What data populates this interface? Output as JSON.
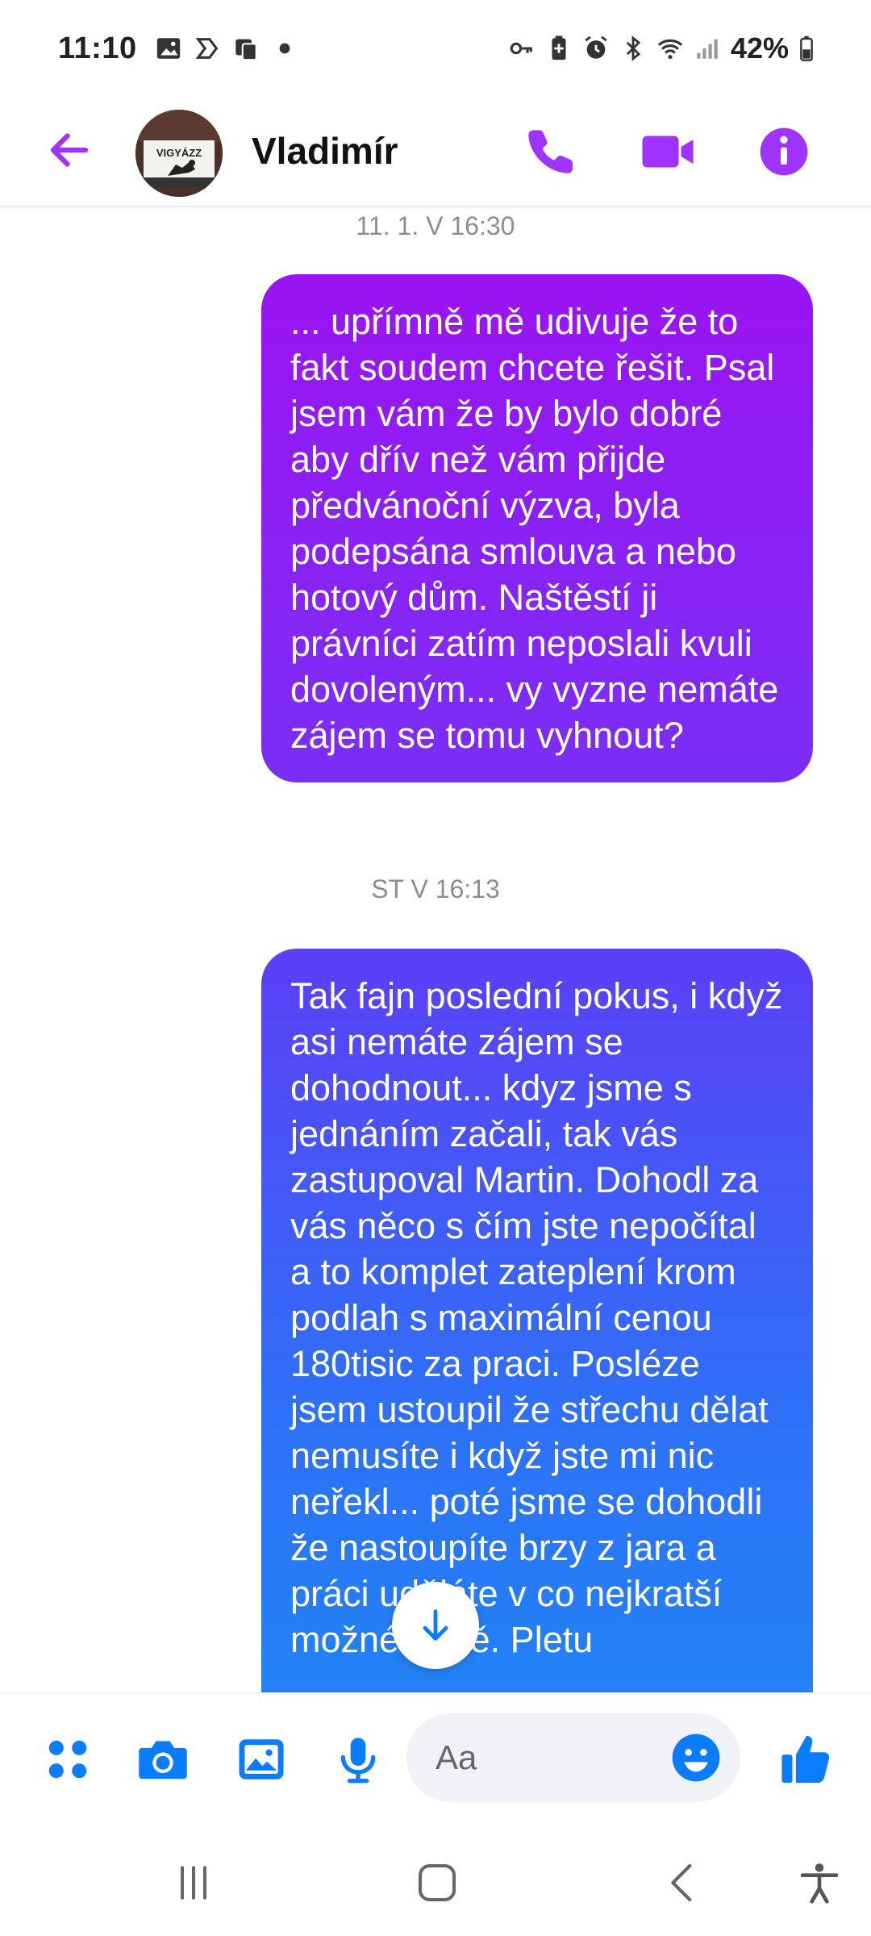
{
  "status_bar": {
    "time": "11:10",
    "battery": "42%",
    "left_icons": [
      "gallery-icon",
      "sync-icon",
      "notification-icon",
      "dot-icon"
    ],
    "right_icons": [
      "key-icon",
      "battery-saver-icon",
      "alarm-icon",
      "bluetooth-icon",
      "wifi-icon",
      "signal-icon"
    ]
  },
  "header": {
    "contact_name": "Vladimír",
    "avatar_text": "VIGYÁZZ",
    "accent_color": "#a033ff"
  },
  "messages": [
    {
      "timestamp": "11. 1. V 16:30",
      "text": "... upřímně mě udivuje že to fakt soudem chcete řešit. Psal jsem vám že by bylo dobré aby dřív než vám přijde předvánoční výzva, byla podepsána smlouva a nebo hotový dům. Naštěstí ji právníci zatím neposlali kvuli dovoleným... vy vyzne nemáte zájem se tomu vyhnout?"
    },
    {
      "timestamp": "ST V 16:13",
      "text": "Tak fajn poslední pokus, i když asi nemáte zájem se dohodnout... kdyz jsme s jednáním začali, tak vás zastupoval Martin. Dohodl za vás něco s čím jste nepočítal a to komplet zateplení krom podlah s maximální cenou 180tisic za praci. Posléze jsem ustoupil že střechu dělat nemusíte i když jste mi nic neřekl... poté jsme se dohodli že nastoupíte brzy z jara a práci uděláte v co nejkratší možné době. Pletu"
    }
  ],
  "composer": {
    "placeholder": "Aa",
    "icons": [
      "apps-icon",
      "camera-icon",
      "image-icon",
      "microphone-icon",
      "emoji-icon",
      "like-icon"
    ],
    "icon_color": "#0a7cff"
  }
}
